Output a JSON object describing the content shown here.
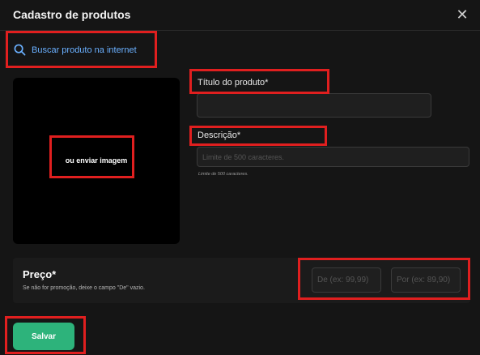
{
  "modal": {
    "title": "Cadastro de produtos",
    "close_icon": "close-icon"
  },
  "search_link": {
    "icon": "search-icon",
    "label": "Buscar produto na internet"
  },
  "image_upload": {
    "label": "ou enviar imagem"
  },
  "product_title": {
    "label": "Título do produto*",
    "value": "",
    "placeholder": ""
  },
  "description": {
    "label": "Descrição*",
    "value": "",
    "placeholder": "Limite de 500 caracteres.",
    "hint": "Limite de 500 caracteres."
  },
  "price": {
    "title": "Preço*",
    "subtitle": "Se não for promoção, deixe o campo \"De\" vazio.",
    "from_placeholder": "De (ex: 99,99)",
    "to_placeholder": "Por (ex: 89,90)"
  },
  "actions": {
    "save_label": "Salvar"
  },
  "colors": {
    "background": "#151515",
    "accent_link": "#6ab0ff",
    "save_button": "#2db37b",
    "annotation_border": "#e01f1f"
  }
}
